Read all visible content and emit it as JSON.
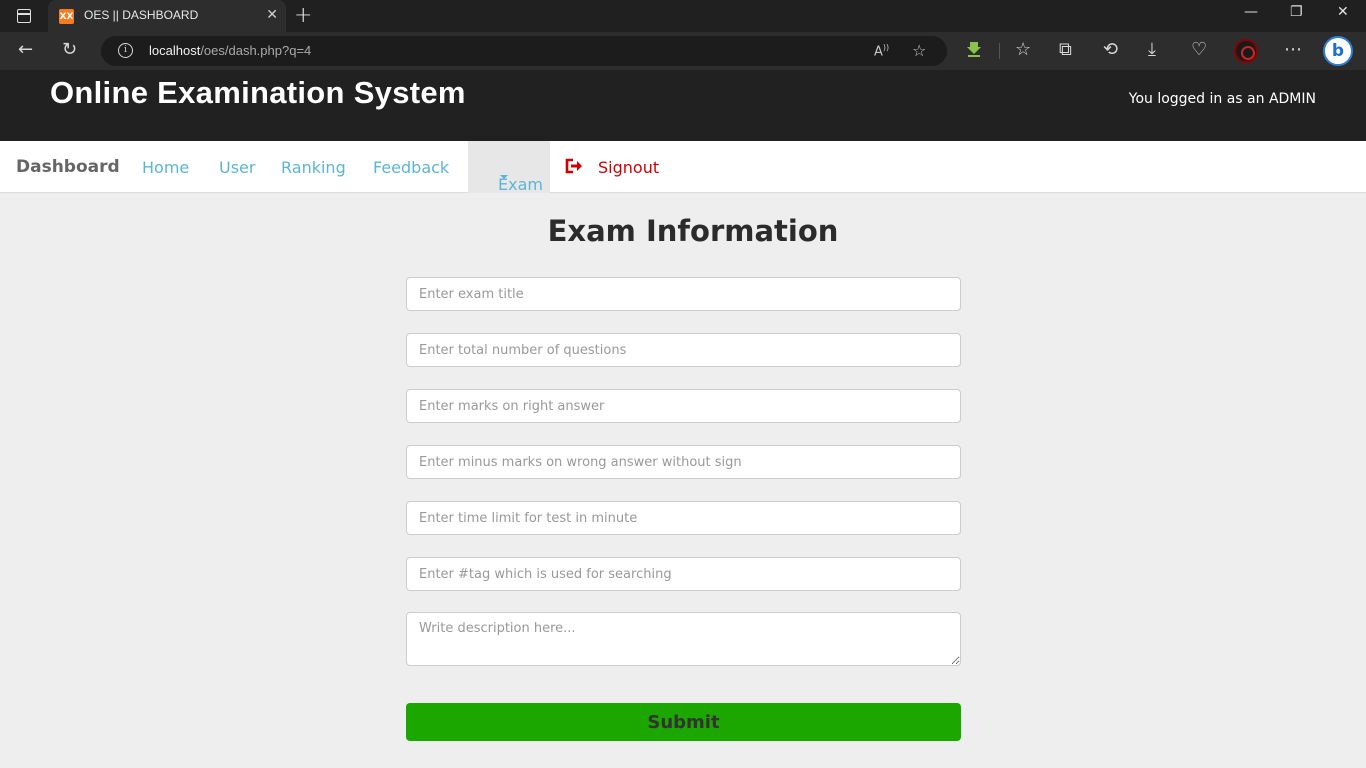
{
  "browser": {
    "tab_title": "OES || DASHBOARD",
    "favicon_text": "XX",
    "url_host": "localhost",
    "url_path": "/oes/dash.php?q=4"
  },
  "header": {
    "site_title": "Online Examination System",
    "logged_in_text": "You logged in as an ADMIN"
  },
  "navbar": {
    "brand": "Dashboard",
    "links": [
      "Home",
      "User",
      "Ranking",
      "Feedback"
    ],
    "exam_label": "Exam",
    "signout_label": "Signout"
  },
  "form": {
    "title": "Exam Information",
    "fields": {
      "title": "Enter exam title",
      "total_questions": "Enter total number of questions",
      "right_marks": "Enter marks on right answer",
      "wrong_marks": "Enter minus marks on wrong answer without sign",
      "time_limit": "Enter time limit for test in minute",
      "tag": "Enter #tag which is used for searching",
      "description": "Write description here..."
    },
    "submit_label": "Submit"
  },
  "colors": {
    "header_bg": "#212121",
    "nav_link": "#5bb5d7",
    "signout": "#d40000",
    "submit_bg": "#1ba600"
  }
}
